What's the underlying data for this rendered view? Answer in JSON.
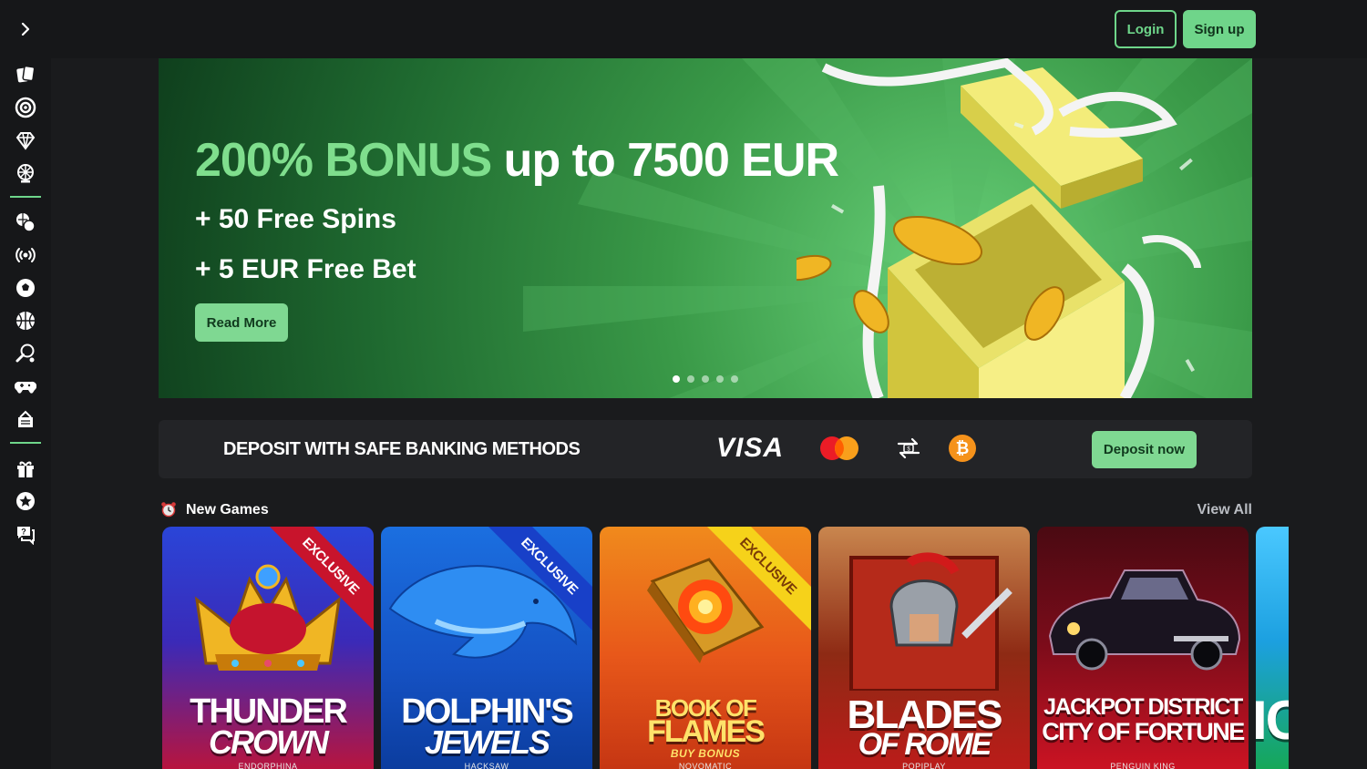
{
  "header": {
    "sidebar_toggle_icon": "chevron-right-icon",
    "login_label": "Login",
    "signup_label": "Sign up",
    "accent_color": "#6fd58a"
  },
  "sidebar": {
    "group_casino": [
      "cards-icon",
      "roulette-icon",
      "diamond-icon",
      "wheel-icon"
    ],
    "group_sports": [
      "sports-icon",
      "live-icon",
      "soccer-icon",
      "basketball-icon",
      "tennis-icon",
      "gamepad-icon",
      "ticket-icon"
    ],
    "group_misc": [
      "gift-icon",
      "star-icon",
      "help-chat-icon"
    ]
  },
  "banner": {
    "headline_accent": "200% BONUS",
    "headline_rest": " up to 7500 EUR",
    "line2": "+ 50 Free Spins",
    "line3": "+ 5 EUR Free Bet",
    "cta_label": "Read More",
    "slide_count": 5,
    "active_slide": 1
  },
  "deposit": {
    "title": "DEPOSIT WITH SAFE BANKING METHODS",
    "methods": [
      "VISA",
      "mastercard-icon",
      "bank-transfer-icon",
      "bitcoin-icon"
    ],
    "visa_label": "VISA",
    "btc_symbol": "₿",
    "cta_label": "Deposit now"
  },
  "new_games": {
    "icon": "alarm-clock-icon",
    "title": "New Games",
    "view_all_label": "View All",
    "games": [
      {
        "title_a": "THUNDER",
        "title_b": "CROWN",
        "provider": "ENDORPHINA",
        "exclusive": "EXCLUSIVE"
      },
      {
        "title_a": "DOLPHIN'S",
        "title_b": "JEWELS",
        "provider": "HACKSAW",
        "exclusive": "EXCLUSIVE"
      },
      {
        "title_a": "BOOK OF",
        "title_b": "FLAMES",
        "subtitle": "BUY BONUS",
        "provider": "NOVOMATIC",
        "exclusive": "EXCLUSIVE"
      },
      {
        "title_a": "BLADES",
        "title_b": "OF ROME",
        "provider": "POPIPLAY"
      },
      {
        "title_a": "JACKPOT DISTRICT",
        "title_b": "CITY OF FORTUNE",
        "provider": "PENGUIN KING"
      },
      {
        "title_a": "IC"
      }
    ]
  }
}
